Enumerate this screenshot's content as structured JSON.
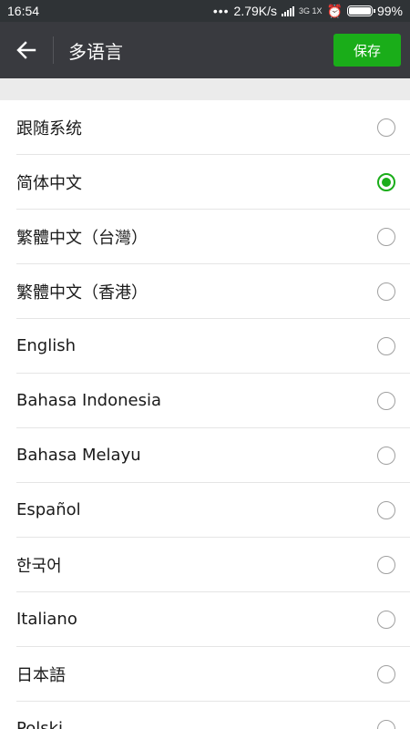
{
  "status_bar": {
    "time": "16:54",
    "dots": "•••",
    "speed": "2.79K/s",
    "network_label": "3G\n1X",
    "battery_percent": "99%",
    "battery_level": 0.99
  },
  "header": {
    "title": "多语言",
    "save_label": "保存"
  },
  "languages": [
    {
      "label": "跟随系统",
      "selected": false
    },
    {
      "label": "简体中文",
      "selected": true
    },
    {
      "label": "繁體中文（台灣）",
      "selected": false
    },
    {
      "label": "繁體中文（香港）",
      "selected": false
    },
    {
      "label": "English",
      "selected": false
    },
    {
      "label": "Bahasa Indonesia",
      "selected": false
    },
    {
      "label": "Bahasa Melayu",
      "selected": false
    },
    {
      "label": "Español",
      "selected": false
    },
    {
      "label": "한국어",
      "selected": false
    },
    {
      "label": "Italiano",
      "selected": false
    },
    {
      "label": "日本語",
      "selected": false
    },
    {
      "label": "Polski",
      "selected": false
    }
  ]
}
